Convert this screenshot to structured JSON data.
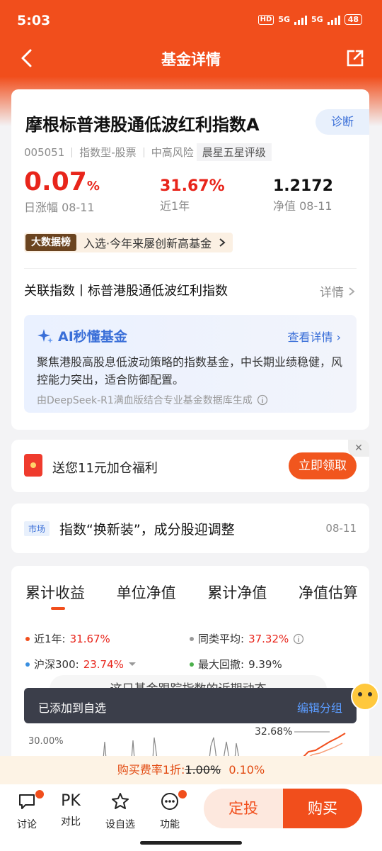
{
  "status": {
    "time": "5:03",
    "net1": "5G",
    "net2": "5G",
    "battery": "48"
  },
  "nav": {
    "title": "基金详情"
  },
  "fund": {
    "name": "摩根标普港股通低波红利指数A",
    "diagnose": "诊断",
    "code": "005051",
    "type": "指数型-股票",
    "risk": "中高风险",
    "rating": "晨星五星评级",
    "daily_change": "0.07",
    "daily_change_unit": "%",
    "daily_label": "日涨幅 08-11",
    "year_return": "31.67%",
    "year_label": "近1年",
    "nav_value": "1.2172",
    "nav_label": "净值 08-11",
    "bigdata_badge": "大数据榜",
    "bigdata_text": "入选·今年来屡创新高基金",
    "assoc_index": "关联指数丨标普港股通低波红利指数",
    "assoc_detail": "详情"
  },
  "ai": {
    "title": "AI秒懂基金",
    "more": "查看详情",
    "text": "聚焦港股高股息低波动策略的指数基金，中长期业绩稳健，风控能力突出，适合防御配置。",
    "source": "由DeepSeek-R1满血版结合专业基金数据库生成"
  },
  "promo": {
    "text": "送您11元加仓福利",
    "button": "立即领取"
  },
  "news": {
    "tag": "市场",
    "title": "指数“换新装”，成分股迎调整",
    "date": "08-11"
  },
  "perf": {
    "tabs": [
      "累计收益",
      "单位净值",
      "累计净值",
      "净值估算"
    ],
    "legend": {
      "year_label": "近1年:",
      "year_value": "31.67%",
      "peer_label": "同类平均:",
      "peer_value": "37.32%",
      "hs300_label": "沪深300:",
      "hs300_value": "23.74%",
      "drawdown_label": "最大回撤:",
      "drawdown_value": "9.39%"
    },
    "chart_hint": "这只基金跟踪指数的近期动态",
    "y_tick": "30.00%",
    "marker_value": "32.68%"
  },
  "toast": {
    "message": "已添加到自选",
    "action": "编辑分组"
  },
  "fee": {
    "prefix": "购买费率1折:",
    "original": "1.00%",
    "current": "0.10%"
  },
  "bottom": {
    "discuss": "讨论",
    "compare_icon": "PK",
    "compare": "对比",
    "watch": "设自选",
    "functions": "功能",
    "dingtou": "定投",
    "buy": "购买"
  },
  "colors": {
    "brand": "#f14e1c",
    "up": "#e8251b",
    "ai": "#3a6fd8"
  }
}
